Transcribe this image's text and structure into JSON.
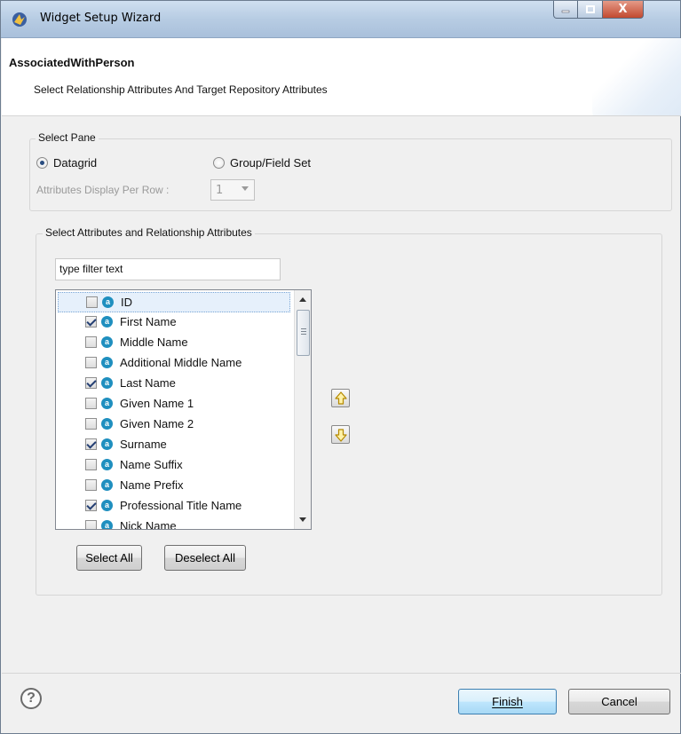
{
  "window": {
    "title": "Widget Setup Wizard",
    "controls": {
      "minimize": "—",
      "maximize": "□",
      "close": "X"
    }
  },
  "header": {
    "title": "AssociatedWithPerson",
    "description": "Select Relationship Attributes And Target Repository Attributes"
  },
  "select_pane": {
    "legend": "Select Pane",
    "options": [
      {
        "label": "Datagrid",
        "selected": true
      },
      {
        "label": "Group/Field Set",
        "selected": false
      }
    ],
    "per_row_label": "Attributes Display Per Row :",
    "per_row_value": "1"
  },
  "attributes": {
    "legend": "Select Attributes and Relationship Attributes",
    "filter_value": "type filter text",
    "items": [
      {
        "label": "ID",
        "checked": false
      },
      {
        "label": "First Name",
        "checked": true
      },
      {
        "label": "Middle Name",
        "checked": false
      },
      {
        "label": "Additional Middle Name",
        "checked": false
      },
      {
        "label": "Last Name",
        "checked": true
      },
      {
        "label": "Given Name 1",
        "checked": false
      },
      {
        "label": "Given Name 2",
        "checked": false
      },
      {
        "label": "Surname",
        "checked": true
      },
      {
        "label": "Name Suffix",
        "checked": false
      },
      {
        "label": "Name Prefix",
        "checked": false
      },
      {
        "label": "Professional Title Name",
        "checked": true
      },
      {
        "label": "Nick Name",
        "checked": false
      }
    ],
    "select_all": "Select All",
    "deselect_all": "Deselect All"
  },
  "footer": {
    "finish": "Finish",
    "cancel": "Cancel",
    "help": "?"
  },
  "colors": {
    "accent": "#3c7fb1",
    "attr_icon": "#1f8fbf"
  }
}
